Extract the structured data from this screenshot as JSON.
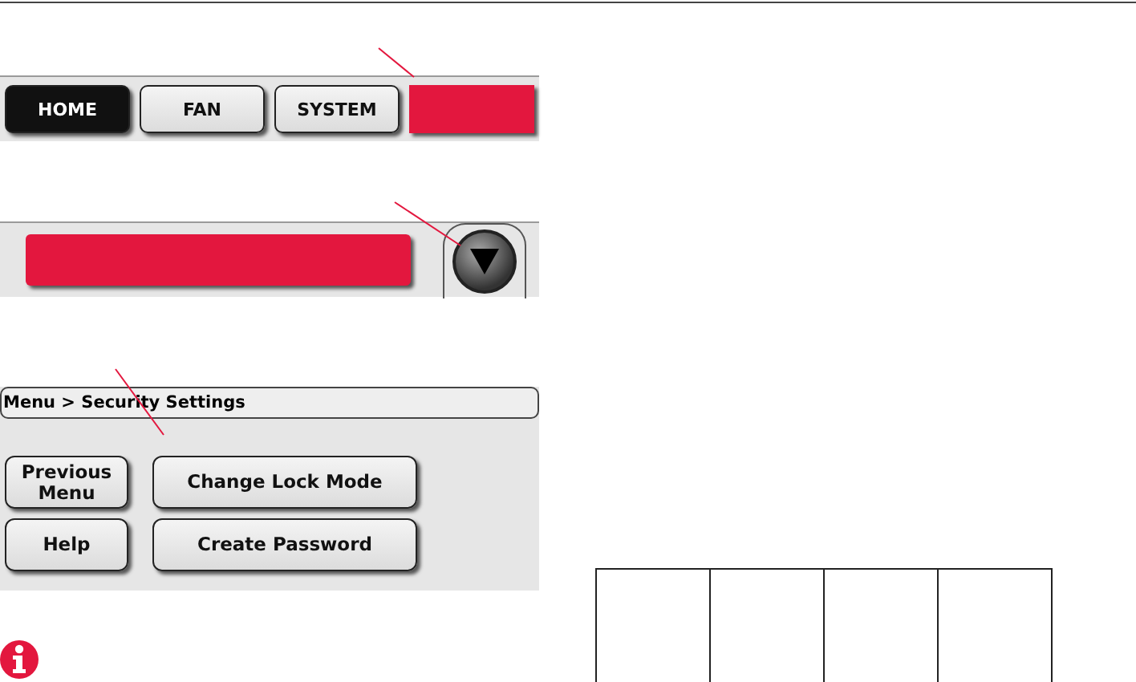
{
  "tab_bar": {
    "tabs": [
      {
        "kind": "tab",
        "label": "HOME",
        "selected": true
      },
      {
        "kind": "tab",
        "label": "FAN",
        "selected": false
      },
      {
        "kind": "tab",
        "label": "SYSTEM",
        "selected": false
      },
      {
        "kind": "highlight"
      }
    ]
  },
  "selector": {
    "kind": "highlight"
  },
  "menu_screen": {
    "breadcrumb": "Menu > Security Settings",
    "buttons": [
      {
        "label": "Previous Menu"
      },
      {
        "label": "Change Lock Mode"
      },
      {
        "label": "Help"
      },
      {
        "label": "Create Password"
      }
    ]
  }
}
